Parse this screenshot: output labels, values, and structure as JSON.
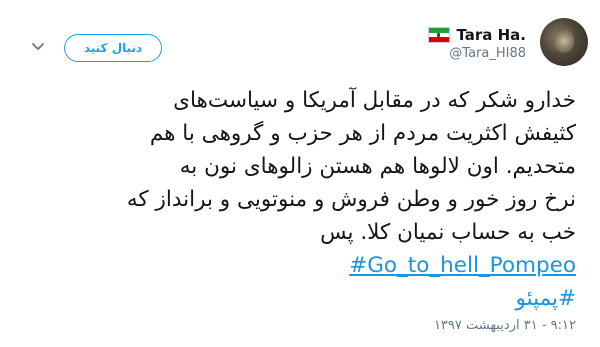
{
  "user": {
    "display_name": "Tara Ha.",
    "handle": "@Tara_HI88",
    "flag": "iran-flag"
  },
  "follow_button": {
    "label": "دنبال کنید"
  },
  "menu": {
    "icon": "chevron-down-icon"
  },
  "tweet": {
    "lines": [
      "خدارو شکر که در مقابل آمریکا و سیاست‌های",
      "کثیفش اکثریت مردم از هر حزب و گروهی با هم",
      "متحدیم. اون لالوها هم هستن زالوهای نون به",
      "نرخ روز خور و وطن فروش و منوتویی و برانداز که",
      "خب به حساب نمیان کلا. پس"
    ],
    "hashtags": [
      "#Go_to_hell_Pompeo",
      "#پمپئو"
    ]
  },
  "timestamp": "۹:۱۲ - ۳۱ اردیبهشت ۱۳۹۷",
  "colors": {
    "link": "#1b95e0",
    "follow": "#1da1f2",
    "text": "#14171a",
    "muted": "#657786"
  }
}
